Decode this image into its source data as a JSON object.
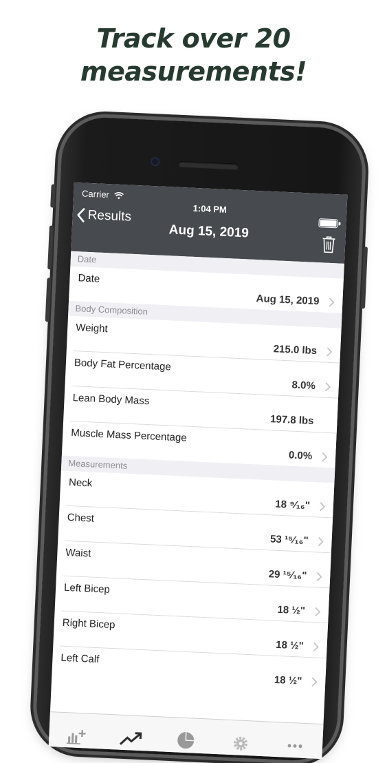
{
  "headline": {
    "line1": "Track over 20",
    "line2": "measurements!"
  },
  "status": {
    "carrier": "Carrier",
    "time": "1:04 PM"
  },
  "nav": {
    "back_label": "Results",
    "title": "Aug 15, 2019"
  },
  "sections": {
    "date": {
      "header": "Date",
      "rows": [
        {
          "label": "Date",
          "value": "Aug 15, 2019"
        }
      ]
    },
    "body": {
      "header": "Body Composition",
      "rows": [
        {
          "label": "Weight",
          "value": "215.0 lbs"
        },
        {
          "label": "Body Fat Percentage",
          "value": "8.0%"
        },
        {
          "label": "Lean Body Mass",
          "value": "197.8 lbs"
        },
        {
          "label": "Muscle Mass Percentage",
          "value": "0.0%"
        }
      ]
    },
    "measurements": {
      "header": "Measurements",
      "rows": [
        {
          "label": "Neck",
          "value": "18 ⁹⁄₁₆\""
        },
        {
          "label": "Chest",
          "value": "53 ¹⁵⁄₁₆\""
        },
        {
          "label": "Waist",
          "value": "29 ¹⁵⁄₁₆\""
        },
        {
          "label": "Left Bicep",
          "value": "18 ½\""
        },
        {
          "label": "Right Bicep",
          "value": "18 ½\""
        },
        {
          "label": "Left Calf",
          "value": "18 ½\""
        }
      ]
    }
  },
  "colors": {
    "navbar": "#474a4e",
    "headline": "#263a30",
    "section_bg": "#efeff4"
  }
}
